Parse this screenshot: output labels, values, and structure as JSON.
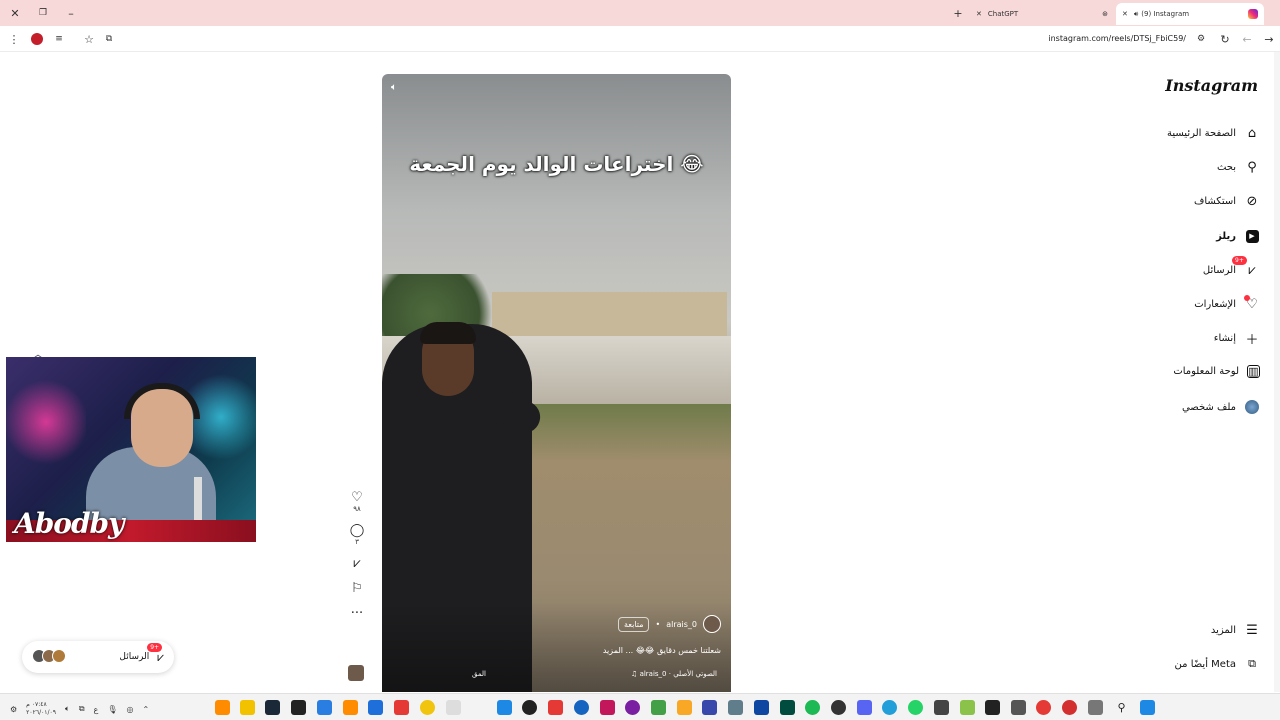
{
  "browser": {
    "tabs": [
      {
        "label": "(9) Instagram",
        "active": true
      },
      {
        "label": "ChatGPT",
        "active": false
      }
    ],
    "url": "instagram.com/reels/DTSj_FbiC59/"
  },
  "sidebar": {
    "logo": "Instagram",
    "items": [
      {
        "label": "الصفحة الرئيسية",
        "icon": "home-icon"
      },
      {
        "label": "بحث",
        "icon": "search-icon"
      },
      {
        "label": "استكشاف",
        "icon": "compass-icon"
      },
      {
        "label": "ريلز",
        "icon": "reels-icon"
      },
      {
        "label": "الرسائل",
        "icon": "messenger-icon",
        "badge": "9+"
      },
      {
        "label": "الإشعارات",
        "icon": "heart-icon"
      },
      {
        "label": "إنشاء",
        "icon": "plus-icon"
      },
      {
        "label": "لوحة المعلومات",
        "icon": "chart-icon"
      },
      {
        "label": "ملف شخصي",
        "icon": "profile-avatar"
      }
    ],
    "more_label": "المزيد",
    "meta_label": "أيضًا من Meta"
  },
  "reel": {
    "overlay_title": "اختراعات الوالد يوم الجمعة 😂",
    "username": "alrais_0",
    "follow_label": "متابعة",
    "caption": "شعلتنا خمس دقايق 😂😂 ... المزيد",
    "audio": "alrais_0 · الصوتي الأصلي",
    "more_short": "المق"
  },
  "actions": {
    "likes": "٩٨",
    "comments": "٣"
  },
  "messages_pill": {
    "label": "الرسائل",
    "badge": "9+"
  },
  "webcam": {
    "overlay_name": "Abodby"
  },
  "taskbar": {
    "time": "٠٧:٤٨ م",
    "date": "٢٠٢٦/٠١/٠٩"
  },
  "colors": {
    "badge": "#ff3040",
    "tabbar": "#f7d9d9"
  }
}
